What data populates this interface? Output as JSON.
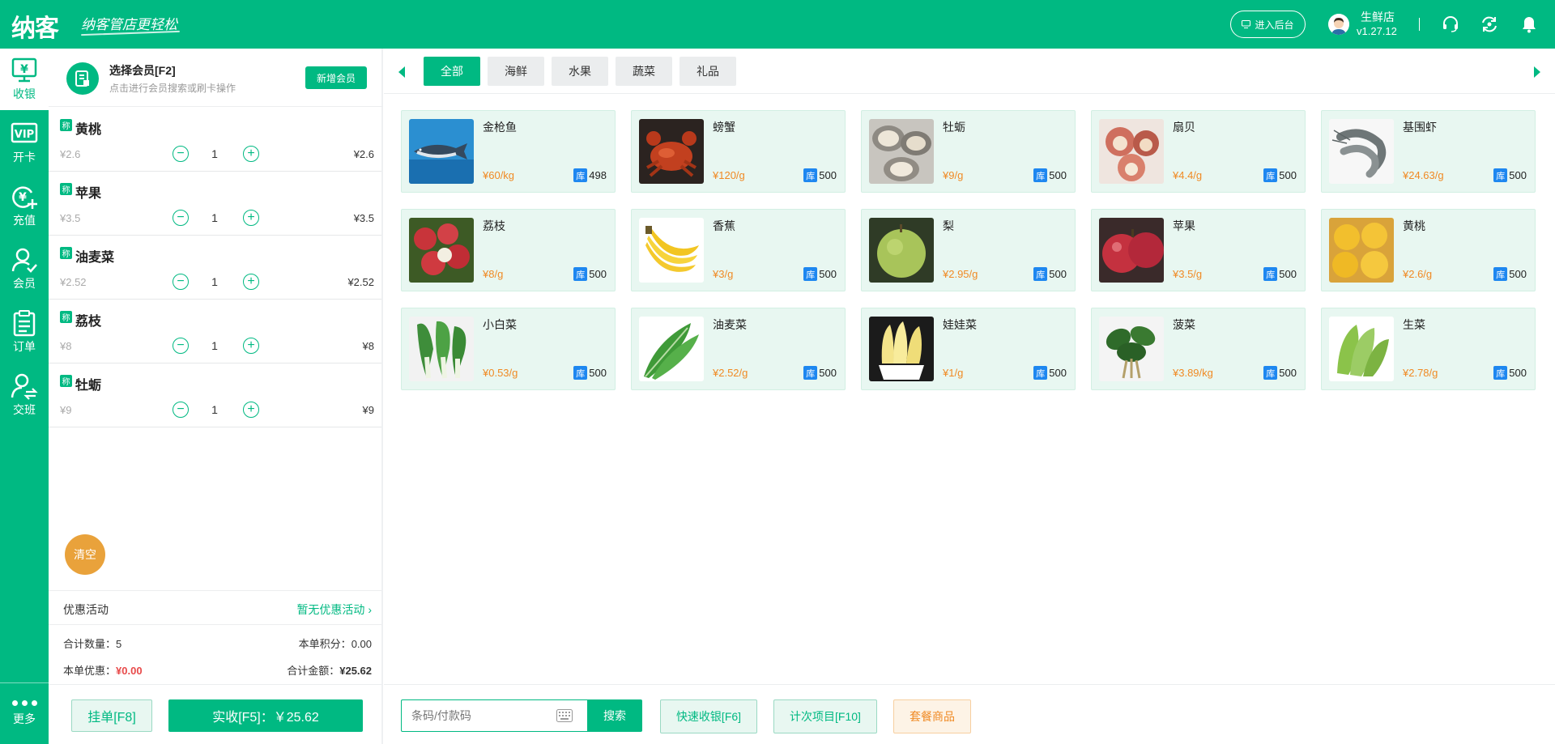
{
  "header": {
    "logo": "纳客",
    "slogan": "纳客管店更轻松",
    "admin_button": "进入后台",
    "store_name": "生鲜店",
    "version": "v1.27.12"
  },
  "nav": {
    "items": [
      {
        "label": "收银",
        "icon": "cashier-icon"
      },
      {
        "label": "开卡",
        "icon": "vip-card-icon"
      },
      {
        "label": "充值",
        "icon": "recharge-icon"
      },
      {
        "label": "会员",
        "icon": "member-icon"
      },
      {
        "label": "订单",
        "icon": "order-icon"
      },
      {
        "label": "交班",
        "icon": "shift-icon"
      }
    ],
    "more": "更多"
  },
  "member": {
    "title": "选择会员[F2]",
    "subtitle": "点击进行会员搜索或刷卡操作",
    "new_button": "新增会员"
  },
  "cart": {
    "tag": "称",
    "items": [
      {
        "name": "黄桃",
        "unit_price": "¥2.6",
        "qty": "1",
        "total": "¥2.6"
      },
      {
        "name": "苹果",
        "unit_price": "¥3.5",
        "qty": "1",
        "total": "¥3.5"
      },
      {
        "name": "油麦菜",
        "unit_price": "¥2.52",
        "qty": "1",
        "total": "¥2.52"
      },
      {
        "name": "荔枝",
        "unit_price": "¥8",
        "qty": "1",
        "total": "¥8"
      },
      {
        "name": "牡蛎",
        "unit_price": "¥9",
        "qty": "1",
        "total": "¥9"
      }
    ],
    "clear_button": "清空",
    "promo_label": "优惠活动",
    "promo_value": "暂无优惠活动",
    "total_qty_label": "合计数量：",
    "total_qty": "5",
    "points_label": "本单积分：",
    "points": "0.00",
    "discount_label": "本单优惠：",
    "discount": "¥0.00",
    "total_amount_label": "合计金额：",
    "total_amount": "¥25.62",
    "hold_button": "挂单[F8]",
    "pay_button": "实收[F5]：￥25.62"
  },
  "tabs": [
    {
      "label": "全部",
      "active": true
    },
    {
      "label": "海鲜",
      "active": false
    },
    {
      "label": "水果",
      "active": false
    },
    {
      "label": "蔬菜",
      "active": false
    },
    {
      "label": "礼品",
      "active": false
    }
  ],
  "stock_badge": "库",
  "products": [
    {
      "name": "金枪鱼",
      "price": "¥60/kg",
      "stock": "498",
      "image": "tuna"
    },
    {
      "name": "螃蟹",
      "price": "¥120/g",
      "stock": "500",
      "image": "crab"
    },
    {
      "name": "牡蛎",
      "price": "¥9/g",
      "stock": "500",
      "image": "oyster"
    },
    {
      "name": "扇贝",
      "price": "¥4.4/g",
      "stock": "500",
      "image": "scallop"
    },
    {
      "name": "基围虾",
      "price": "¥24.63/g",
      "stock": "500",
      "image": "shrimp"
    },
    {
      "name": "荔枝",
      "price": "¥8/g",
      "stock": "500",
      "image": "lychee"
    },
    {
      "name": "香蕉",
      "price": "¥3/g",
      "stock": "500",
      "image": "banana"
    },
    {
      "name": "梨",
      "price": "¥2.95/g",
      "stock": "500",
      "image": "pear"
    },
    {
      "name": "苹果",
      "price": "¥3.5/g",
      "stock": "500",
      "image": "apple"
    },
    {
      "name": "黄桃",
      "price": "¥2.6/g",
      "stock": "500",
      "image": "peach"
    },
    {
      "name": "小白菜",
      "price": "¥0.53/g",
      "stock": "500",
      "image": "bok-choy"
    },
    {
      "name": "油麦菜",
      "price": "¥2.52/g",
      "stock": "500",
      "image": "lettuce-leaf"
    },
    {
      "name": "娃娃菜",
      "price": "¥1/g",
      "stock": "500",
      "image": "baby-cabbage"
    },
    {
      "name": "菠菜",
      "price": "¥3.89/kg",
      "stock": "500",
      "image": "spinach"
    },
    {
      "name": "生菜",
      "price": "¥2.78/g",
      "stock": "500",
      "image": "romaine"
    }
  ],
  "bottom": {
    "barcode_placeholder": "条码/付款码",
    "search_button": "搜索",
    "quick_cashier": "快速收银[F6]",
    "count_items": "计次项目[F10]",
    "package_goods": "套餐商品"
  },
  "colors": {
    "brand": "#00b982",
    "price": "#f08a24",
    "stock_badge": "#1e87f0",
    "discount": "#e84a4a",
    "clear": "#e9a23b"
  }
}
